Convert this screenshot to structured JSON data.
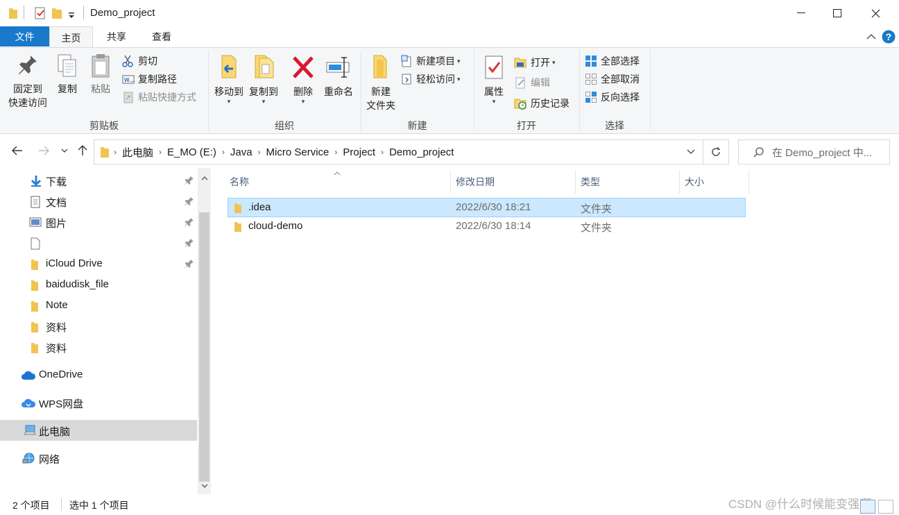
{
  "window": {
    "title": "Demo_project",
    "minimize": "—",
    "maximize": "☐",
    "close": "✕"
  },
  "tabs": {
    "file": "文件",
    "home": "主页",
    "share": "共享",
    "view": "查看"
  },
  "ribbon": {
    "clipboard": {
      "label": "剪贴板",
      "pin_line1": "固定到",
      "pin_line2": "快速访问",
      "copy": "复制",
      "paste": "粘贴",
      "cut": "剪切",
      "copy_path": "复制路径",
      "paste_shortcut": "粘贴快捷方式"
    },
    "organize": {
      "label": "组织",
      "move_to": "移动到",
      "copy_to": "复制到",
      "delete": "删除",
      "rename": "重命名"
    },
    "new": {
      "label": "新建",
      "new_folder_line1": "新建",
      "new_folder_line2": "文件夹",
      "new_item": "新建项目",
      "easy_access": "轻松访问"
    },
    "open": {
      "label": "打开",
      "properties": "属性",
      "open": "打开",
      "edit": "编辑",
      "history": "历史记录"
    },
    "select": {
      "label": "选择",
      "select_all": "全部选择",
      "select_none": "全部取消",
      "invert": "反向选择"
    }
  },
  "address": {
    "crumbs": [
      "此电脑",
      "E_MO (E:)",
      "Java",
      "Micro Service",
      "Project",
      "Demo_project"
    ]
  },
  "search": {
    "placeholder": "在 Demo_project 中..."
  },
  "navpane": {
    "items": [
      {
        "label": "下载"
      },
      {
        "label": "文档"
      },
      {
        "label": "图片"
      },
      {
        "label": ""
      },
      {
        "label": "iCloud Drive"
      },
      {
        "label": "baidudisk_file"
      },
      {
        "label": "Note"
      },
      {
        "label": "资料"
      },
      {
        "label": "资料"
      },
      {
        "label": "OneDrive"
      },
      {
        "label": "WPS网盘"
      },
      {
        "label": "此电脑"
      },
      {
        "label": "网络"
      }
    ]
  },
  "filelist": {
    "columns": {
      "name": "名称",
      "modified": "修改日期",
      "type": "类型",
      "size": "大小"
    },
    "rows": [
      {
        "name": ".idea",
        "modified": "2022/6/30 18:21",
        "type": "文件夹",
        "size": ""
      },
      {
        "name": "cloud-demo",
        "modified": "2022/6/30 18:14",
        "type": "文件夹",
        "size": ""
      }
    ]
  },
  "status": {
    "count": "2 个项目",
    "selected": "选中 1 个项目",
    "watermark": "CSDN @什么时候能变强啊"
  },
  "colors": {
    "accent": "#1979ca",
    "selection": "#cce8ff",
    "folder": "#f8d775"
  }
}
